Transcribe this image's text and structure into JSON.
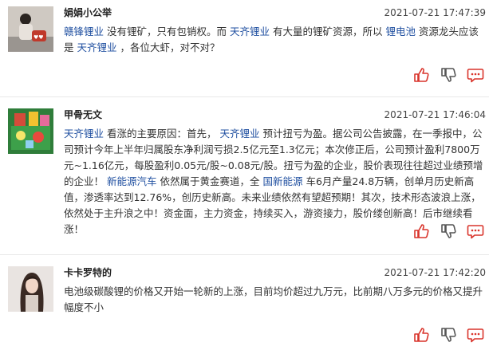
{
  "posts": [
    {
      "username": "娟娟小公举",
      "timestamp": "2021-07-21 17:47:39",
      "content": [
        {
          "text": "赣锋锂业",
          "tag": true
        },
        {
          "text": " 没有锂矿，只有包销权。而 ",
          "tag": false
        },
        {
          "text": "天齐锂业",
          "tag": true
        },
        {
          "text": " 有大量的锂矿资源，所以 ",
          "tag": false
        },
        {
          "text": "锂电池",
          "tag": true
        },
        {
          "text": " 资源龙头应该是 ",
          "tag": false
        },
        {
          "text": "天齐锂业",
          "tag": true
        },
        {
          "text": " ，各位大虾，对不对？",
          "tag": false
        }
      ]
    },
    {
      "username": "甲骨无文",
      "timestamp": "2021-07-21 17:46:04",
      "content": [
        {
          "text": "天齐锂业",
          "tag": true
        },
        {
          "text": " 看涨的主要原因：首先， ",
          "tag": false
        },
        {
          "text": "天齐锂业",
          "tag": true
        },
        {
          "text": " 预计扭亏为盈。据公司公告披露，在一季报中，公司预计今年上半年归属股东净利润亏损2.5亿元至1.3亿元；本次修正后，公司预计盈利7800万元~1.16亿元，每股盈利0.05元/股~0.08元/股。扭亏为盈的企业，股价表现往往超过业绩预增的企业！ ",
          "tag": false
        },
        {
          "text": "新能源汽车",
          "tag": true
        },
        {
          "text": " 依然属于黄金赛道，全 ",
          "tag": false
        },
        {
          "text": "国新能源",
          "tag": true
        },
        {
          "text": " 车6月产量24.8万辆，创单月历史新高值，渗透率达到12.76%，创历史新高。未来业绩依然有望超预期！其次，技术形态波浪上涨，依然处于主升浪之中！资金面，主力资金，持续买入，游资接力，股价缕创新高！后市继续看涨！",
          "tag": false
        }
      ]
    },
    {
      "username": "卡卡罗特的",
      "timestamp": "2021-07-21 17:42:20",
      "content": [
        {
          "text": "电池级碳酸锂的价格又开始一轮新的上涨，目前均价超过九万元，比前期八万多元的价格又提升幅度不小",
          "tag": false
        }
      ]
    }
  ],
  "colors": {
    "like": "#d9342b",
    "dislike": "#555555",
    "comment": "#d9342b",
    "tag": "#1f4fa0"
  },
  "icons": [
    "thumbs-up-icon",
    "thumbs-down-icon",
    "comment-icon"
  ]
}
